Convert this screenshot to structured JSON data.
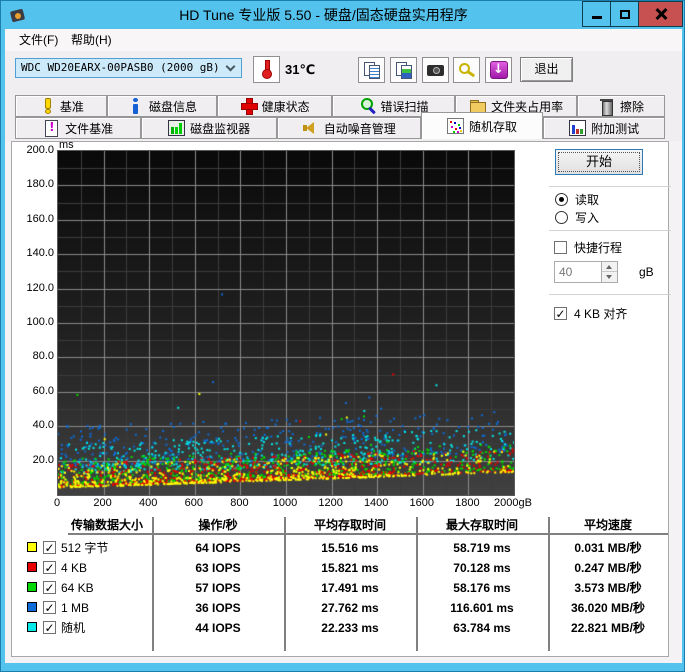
{
  "window": {
    "title": "HD Tune 专业版 5.50 - 硬盘/固态硬盘实用程序",
    "buttons": [
      "minimize",
      "maximize",
      "close"
    ]
  },
  "menu": {
    "items": [
      "文件(F)",
      "帮助(H)"
    ]
  },
  "toolbar": {
    "drive_selected": "WDC WD20EARX-00PASB0 (2000 gB)",
    "temperature": "31℃",
    "buttons": [
      {
        "name": "copy-text-icon"
      },
      {
        "name": "copy-image-icon"
      },
      {
        "name": "camera-icon"
      },
      {
        "name": "options-icon"
      },
      {
        "name": "save-icon"
      }
    ],
    "exit_label": "退出"
  },
  "tabs": {
    "row1": [
      {
        "label": "基准",
        "icon": "benchmark-icon",
        "selected": false
      },
      {
        "label": "磁盘信息",
        "icon": "info-icon",
        "selected": false
      },
      {
        "label": "健康状态",
        "icon": "health-icon",
        "selected": false
      },
      {
        "label": "错误扫描",
        "icon": "scan-icon",
        "selected": false
      },
      {
        "label": "文件夹占用率",
        "icon": "folder-icon",
        "selected": false
      },
      {
        "label": "擦除",
        "icon": "erase-icon",
        "selected": false
      }
    ],
    "row2": [
      {
        "label": "文件基准",
        "icon": "file-benchmark-icon",
        "selected": false
      },
      {
        "label": "磁盘监视器",
        "icon": "monitor-icon",
        "selected": false
      },
      {
        "label": "自动噪音管理",
        "icon": "aam-icon",
        "selected": false
      },
      {
        "label": "随机存取",
        "icon": "random-access-icon",
        "selected": true
      },
      {
        "label": "附加测试",
        "icon": "extra-tests-icon",
        "selected": false
      }
    ]
  },
  "controls": {
    "start_label": "开始",
    "read_label": "读取",
    "write_label": "写入",
    "read_selected": true,
    "write_selected": false,
    "short_stroke_label": "快捷行程",
    "short_stroke_checked": false,
    "capacity_value": "40",
    "capacity_unit": "gB",
    "align_label": "4 KB 对齐",
    "align_checked": true
  },
  "chart_data": {
    "type": "scatter",
    "x_unit": "gB",
    "y_unit": "ms",
    "x_range": [
      0,
      2000
    ],
    "y_range": [
      0,
      200
    ],
    "x_ticks": [
      0,
      200,
      400,
      600,
      800,
      1000,
      1200,
      1400,
      1600,
      1800,
      2000
    ],
    "x_tick_labels": [
      "0",
      "200",
      "400",
      "600",
      "800",
      "1000",
      "1200",
      "1400",
      "1600",
      "1800",
      "2000gB"
    ],
    "y_ticks": [
      20,
      40,
      60,
      80,
      100,
      120,
      140,
      160,
      180,
      200
    ],
    "y_tick_labels": [
      "20.0",
      "40.0",
      "60.0",
      "80.0",
      "100.0",
      "120.0",
      "140.0",
      "160.0",
      "180.0",
      "200.0"
    ],
    "grid_minor_x": 100,
    "grid_minor_y": 10,
    "grid": true,
    "envelope": {
      "base_ms": 4,
      "rise_ms": 9
    },
    "sparse_after_x": 1500,
    "sparse_keep_p": 0.55,
    "series": [
      {
        "name": "512 字节",
        "color": "#ffff00",
        "count": 700,
        "offset_min": 0.3,
        "offset_spread": 13,
        "pow": 2.6,
        "outlier_p": 0.004,
        "outlier_extra": 22,
        "avg_ms": 15.516,
        "max_ms": 58.719,
        "max_point": {
          "x": 620,
          "y": 58.7
        }
      },
      {
        "name": "4 KB",
        "color": "#e80000",
        "count": 700,
        "offset_min": 0.8,
        "offset_spread": 14,
        "pow": 2.4,
        "outlier_p": 0.004,
        "outlier_extra": 30,
        "avg_ms": 15.821,
        "max_ms": 70.128,
        "max_point": {
          "x": 1470,
          "y": 70.1
        }
      },
      {
        "name": "64 KB",
        "color": "#00d800",
        "count": 700,
        "offset_min": 2.0,
        "offset_spread": 15,
        "pow": 2.2,
        "outlier_p": 0.006,
        "outlier_extra": 30,
        "avg_ms": 17.491,
        "max_ms": 58.176,
        "max_point": {
          "x": 85,
          "y": 58.2
        }
      },
      {
        "name": "1 MB",
        "color": "#0b6cd8",
        "count": 460,
        "offset_min": 12.0,
        "offset_spread": 24,
        "pow": 1.7,
        "outlier_p": 0.015,
        "outlier_extra": 30,
        "avg_ms": 27.762,
        "max_ms": 116.601,
        "max_point": {
          "x": 720,
          "y": 116.6
        }
      },
      {
        "name": "随机",
        "color": "#00e8e8",
        "count": 460,
        "offset_min": 8.0,
        "offset_spread": 18,
        "pow": 1.6,
        "outlier_p": 0.01,
        "outlier_extra": 28,
        "avg_ms": 22.233,
        "max_ms": 63.784,
        "max_point": {
          "x": 1660,
          "y": 63.8
        }
      }
    ]
  },
  "table": {
    "headers": [
      "传输数据大小",
      "操作/秒",
      "平均存取时间",
      "最大存取时间",
      "平均速度"
    ],
    "rows": [
      {
        "color": "#ffff00",
        "checked": true,
        "label": "512 字节",
        "iops": "64 IOPS",
        "avg": "15.516 ms",
        "max": "58.719 ms",
        "speed": "0.031 MB/秒"
      },
      {
        "color": "#e80000",
        "checked": true,
        "label": "4 KB",
        "iops": "63 IOPS",
        "avg": "15.821 ms",
        "max": "70.128 ms",
        "speed": "0.247 MB/秒"
      },
      {
        "color": "#00d800",
        "checked": true,
        "label": "64 KB",
        "iops": "57 IOPS",
        "avg": "17.491 ms",
        "max": "58.176 ms",
        "speed": "3.573 MB/秒"
      },
      {
        "color": "#0b6cd8",
        "checked": true,
        "label": "1 MB",
        "iops": "36 IOPS",
        "avg": "27.762 ms",
        "max": "116.601 ms",
        "speed": "36.020 MB/秒"
      },
      {
        "color": "#00e8e8",
        "checked": true,
        "label": "随机",
        "iops": "44 IOPS",
        "avg": "22.233 ms",
        "max": "63.784 ms",
        "speed": "22.821 MB/秒"
      }
    ]
  }
}
